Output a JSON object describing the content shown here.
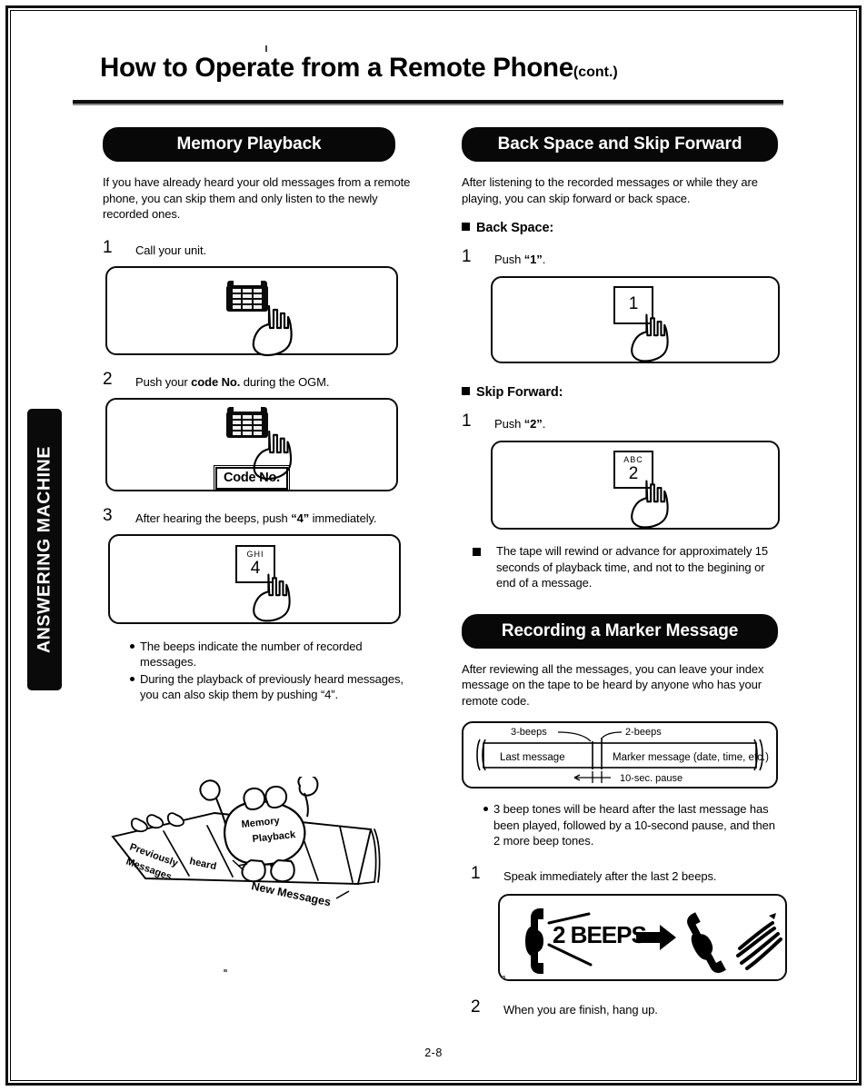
{
  "document": {
    "title": "How to Operate from a Remote Phone",
    "title_suffix": "(cont.)",
    "page_number": "2-8",
    "side_tab": "ANSWERING MACHINE"
  },
  "left_column": {
    "section_title": "Memory Playback",
    "intro": "If you have already heard your old messages from a remote phone, you can skip them and only listen to the newly recorded ones.",
    "steps": [
      {
        "number": "1",
        "text": "Call your unit.",
        "illustration": "telephone-keypad-with-finger"
      },
      {
        "number": "2",
        "text_before": "Push your ",
        "text_bold": "code No.",
        "text_after": " during the OGM.",
        "illustration": "telephone-keypad-with-finger",
        "label": "Code No."
      },
      {
        "number": "3",
        "text_before": "After hearing the beeps, push ",
        "text_bold": "“4”",
        "text_after": " immediately.",
        "illustration": "keycap-4",
        "keycap_letters": "GHI",
        "keycap_digit": "4"
      }
    ],
    "bullets": [
      "The beeps indicate the number of recorded messages.",
      "During the playback of previously heard messages, you can also skip them by pushing “4”."
    ],
    "cartoon": {
      "character_label_line1": "Memory",
      "character_label_line2": "Playback",
      "tape_label_left_line1": "Previously",
      "tape_label_left_line2": "Messages",
      "tape_label_left_line3": "heard",
      "tape_label_right": "New Messages"
    }
  },
  "right_column": {
    "section_one": {
      "section_title": "Back Space and Skip Forward",
      "intro": "After listening to the recorded messages or while they are playing, you can skip forward or back space.",
      "sub_sections": [
        {
          "heading": "Back Space:",
          "step_number": "1",
          "step_text_before": "Push ",
          "step_text_bold": "“1”",
          "step_text_after": ".",
          "keycap_letters": "",
          "keycap_digit": "1"
        },
        {
          "heading": "Skip Forward:",
          "step_number": "1",
          "step_text_before": "Push ",
          "step_text_bold": "“2”",
          "step_text_after": ".",
          "keycap_letters": "ABC",
          "keycap_digit": "2"
        }
      ],
      "note": "The tape will rewind or advance for approximately 15 seconds of playback time, and not to the begining or end of a message."
    },
    "section_two": {
      "section_title": "Recording a Marker Message",
      "intro": "After reviewing all the messages, you can leave your index message on the tape to be heard by anyone who has your remote code.",
      "tape_diagram": {
        "label_3beeps": "3-beeps",
        "label_2beeps": "2-beeps",
        "segment_left": "Last message",
        "segment_right": "Marker message (date, time, etc.)",
        "label_pause": "10-sec. pause"
      },
      "bullets": [
        "3 beep tones will be heard after the last message has been played, followed by a 10-second pause, and then 2 more beep tones."
      ],
      "steps": [
        {
          "number": "1",
          "text": "Speak immediately after the last 2 beeps.",
          "illustration": "handset-2beeps-arrow-handset",
          "illustration_text": "2 BEEPS"
        },
        {
          "number": "2",
          "text": "When you are finish, hang up.",
          "illustration": null
        }
      ]
    }
  },
  "colors": {
    "ink": "#000000",
    "pill_background": "#080808",
    "paper": "#ffffff"
  }
}
